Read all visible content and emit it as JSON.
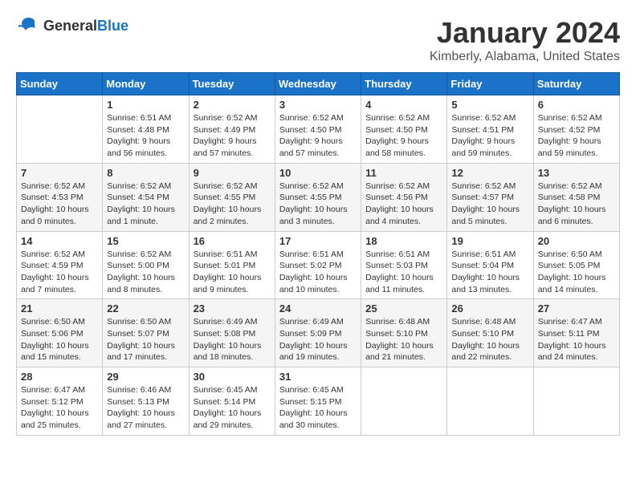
{
  "header": {
    "logo": {
      "general": "General",
      "blue": "Blue"
    },
    "title": "January 2024",
    "location": "Kimberly, Alabama, United States"
  },
  "calendar": {
    "weekdays": [
      "Sunday",
      "Monday",
      "Tuesday",
      "Wednesday",
      "Thursday",
      "Friday",
      "Saturday"
    ],
    "weeks": [
      [
        {
          "day": "",
          "sunrise": "",
          "sunset": "",
          "daylight": ""
        },
        {
          "day": "1",
          "sunrise": "Sunrise: 6:51 AM",
          "sunset": "Sunset: 4:48 PM",
          "daylight": "Daylight: 9 hours and 56 minutes."
        },
        {
          "day": "2",
          "sunrise": "Sunrise: 6:52 AM",
          "sunset": "Sunset: 4:49 PM",
          "daylight": "Daylight: 9 hours and 57 minutes."
        },
        {
          "day": "3",
          "sunrise": "Sunrise: 6:52 AM",
          "sunset": "Sunset: 4:50 PM",
          "daylight": "Daylight: 9 hours and 57 minutes."
        },
        {
          "day": "4",
          "sunrise": "Sunrise: 6:52 AM",
          "sunset": "Sunset: 4:50 PM",
          "daylight": "Daylight: 9 hours and 58 minutes."
        },
        {
          "day": "5",
          "sunrise": "Sunrise: 6:52 AM",
          "sunset": "Sunset: 4:51 PM",
          "daylight": "Daylight: 9 hours and 59 minutes."
        },
        {
          "day": "6",
          "sunrise": "Sunrise: 6:52 AM",
          "sunset": "Sunset: 4:52 PM",
          "daylight": "Daylight: 9 hours and 59 minutes."
        }
      ],
      [
        {
          "day": "7",
          "sunrise": "Sunrise: 6:52 AM",
          "sunset": "Sunset: 4:53 PM",
          "daylight": "Daylight: 10 hours and 0 minutes."
        },
        {
          "day": "8",
          "sunrise": "Sunrise: 6:52 AM",
          "sunset": "Sunset: 4:54 PM",
          "daylight": "Daylight: 10 hours and 1 minute."
        },
        {
          "day": "9",
          "sunrise": "Sunrise: 6:52 AM",
          "sunset": "Sunset: 4:55 PM",
          "daylight": "Daylight: 10 hours and 2 minutes."
        },
        {
          "day": "10",
          "sunrise": "Sunrise: 6:52 AM",
          "sunset": "Sunset: 4:55 PM",
          "daylight": "Daylight: 10 hours and 3 minutes."
        },
        {
          "day": "11",
          "sunrise": "Sunrise: 6:52 AM",
          "sunset": "Sunset: 4:56 PM",
          "daylight": "Daylight: 10 hours and 4 minutes."
        },
        {
          "day": "12",
          "sunrise": "Sunrise: 6:52 AM",
          "sunset": "Sunset: 4:57 PM",
          "daylight": "Daylight: 10 hours and 5 minutes."
        },
        {
          "day": "13",
          "sunrise": "Sunrise: 6:52 AM",
          "sunset": "Sunset: 4:58 PM",
          "daylight": "Daylight: 10 hours and 6 minutes."
        }
      ],
      [
        {
          "day": "14",
          "sunrise": "Sunrise: 6:52 AM",
          "sunset": "Sunset: 4:59 PM",
          "daylight": "Daylight: 10 hours and 7 minutes."
        },
        {
          "day": "15",
          "sunrise": "Sunrise: 6:52 AM",
          "sunset": "Sunset: 5:00 PM",
          "daylight": "Daylight: 10 hours and 8 minutes."
        },
        {
          "day": "16",
          "sunrise": "Sunrise: 6:51 AM",
          "sunset": "Sunset: 5:01 PM",
          "daylight": "Daylight: 10 hours and 9 minutes."
        },
        {
          "day": "17",
          "sunrise": "Sunrise: 6:51 AM",
          "sunset": "Sunset: 5:02 PM",
          "daylight": "Daylight: 10 hours and 10 minutes."
        },
        {
          "day": "18",
          "sunrise": "Sunrise: 6:51 AM",
          "sunset": "Sunset: 5:03 PM",
          "daylight": "Daylight: 10 hours and 11 minutes."
        },
        {
          "day": "19",
          "sunrise": "Sunrise: 6:51 AM",
          "sunset": "Sunset: 5:04 PM",
          "daylight": "Daylight: 10 hours and 13 minutes."
        },
        {
          "day": "20",
          "sunrise": "Sunrise: 6:50 AM",
          "sunset": "Sunset: 5:05 PM",
          "daylight": "Daylight: 10 hours and 14 minutes."
        }
      ],
      [
        {
          "day": "21",
          "sunrise": "Sunrise: 6:50 AM",
          "sunset": "Sunset: 5:06 PM",
          "daylight": "Daylight: 10 hours and 15 minutes."
        },
        {
          "day": "22",
          "sunrise": "Sunrise: 6:50 AM",
          "sunset": "Sunset: 5:07 PM",
          "daylight": "Daylight: 10 hours and 17 minutes."
        },
        {
          "day": "23",
          "sunrise": "Sunrise: 6:49 AM",
          "sunset": "Sunset: 5:08 PM",
          "daylight": "Daylight: 10 hours and 18 minutes."
        },
        {
          "day": "24",
          "sunrise": "Sunrise: 6:49 AM",
          "sunset": "Sunset: 5:09 PM",
          "daylight": "Daylight: 10 hours and 19 minutes."
        },
        {
          "day": "25",
          "sunrise": "Sunrise: 6:48 AM",
          "sunset": "Sunset: 5:10 PM",
          "daylight": "Daylight: 10 hours and 21 minutes."
        },
        {
          "day": "26",
          "sunrise": "Sunrise: 6:48 AM",
          "sunset": "Sunset: 5:10 PM",
          "daylight": "Daylight: 10 hours and 22 minutes."
        },
        {
          "day": "27",
          "sunrise": "Sunrise: 6:47 AM",
          "sunset": "Sunset: 5:11 PM",
          "daylight": "Daylight: 10 hours and 24 minutes."
        }
      ],
      [
        {
          "day": "28",
          "sunrise": "Sunrise: 6:47 AM",
          "sunset": "Sunset: 5:12 PM",
          "daylight": "Daylight: 10 hours and 25 minutes."
        },
        {
          "day": "29",
          "sunrise": "Sunrise: 6:46 AM",
          "sunset": "Sunset: 5:13 PM",
          "daylight": "Daylight: 10 hours and 27 minutes."
        },
        {
          "day": "30",
          "sunrise": "Sunrise: 6:45 AM",
          "sunset": "Sunset: 5:14 PM",
          "daylight": "Daylight: 10 hours and 29 minutes."
        },
        {
          "day": "31",
          "sunrise": "Sunrise: 6:45 AM",
          "sunset": "Sunset: 5:15 PM",
          "daylight": "Daylight: 10 hours and 30 minutes."
        },
        {
          "day": "",
          "sunrise": "",
          "sunset": "",
          "daylight": ""
        },
        {
          "day": "",
          "sunrise": "",
          "sunset": "",
          "daylight": ""
        },
        {
          "day": "",
          "sunrise": "",
          "sunset": "",
          "daylight": ""
        }
      ]
    ]
  }
}
